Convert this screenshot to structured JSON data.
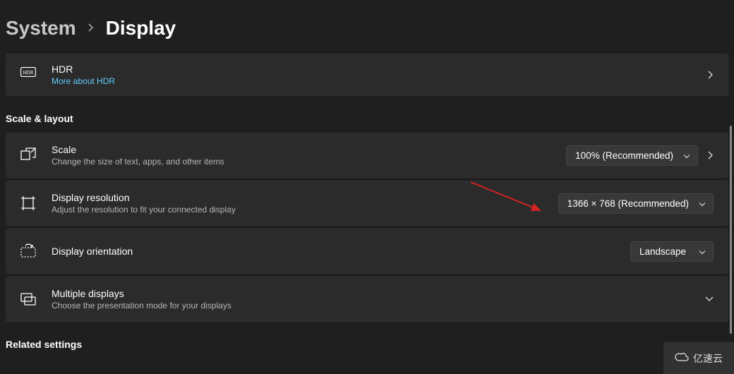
{
  "breadcrumb": {
    "parent": "System",
    "current": "Display"
  },
  "hdr": {
    "title": "HDR",
    "sub": "More about HDR"
  },
  "section_scale_layout": "Scale & layout",
  "scale": {
    "title": "Scale",
    "sub": "Change the size of text, apps, and other items",
    "value": "100% (Recommended)"
  },
  "resolution": {
    "title": "Display resolution",
    "sub": "Adjust the resolution to fit your connected display",
    "value": "1366 × 768 (Recommended)"
  },
  "orientation": {
    "title": "Display orientation",
    "value": "Landscape"
  },
  "multiple": {
    "title": "Multiple displays",
    "sub": "Choose the presentation mode for your displays"
  },
  "section_related": "Related settings",
  "watermark": {
    "text": "亿速云"
  }
}
